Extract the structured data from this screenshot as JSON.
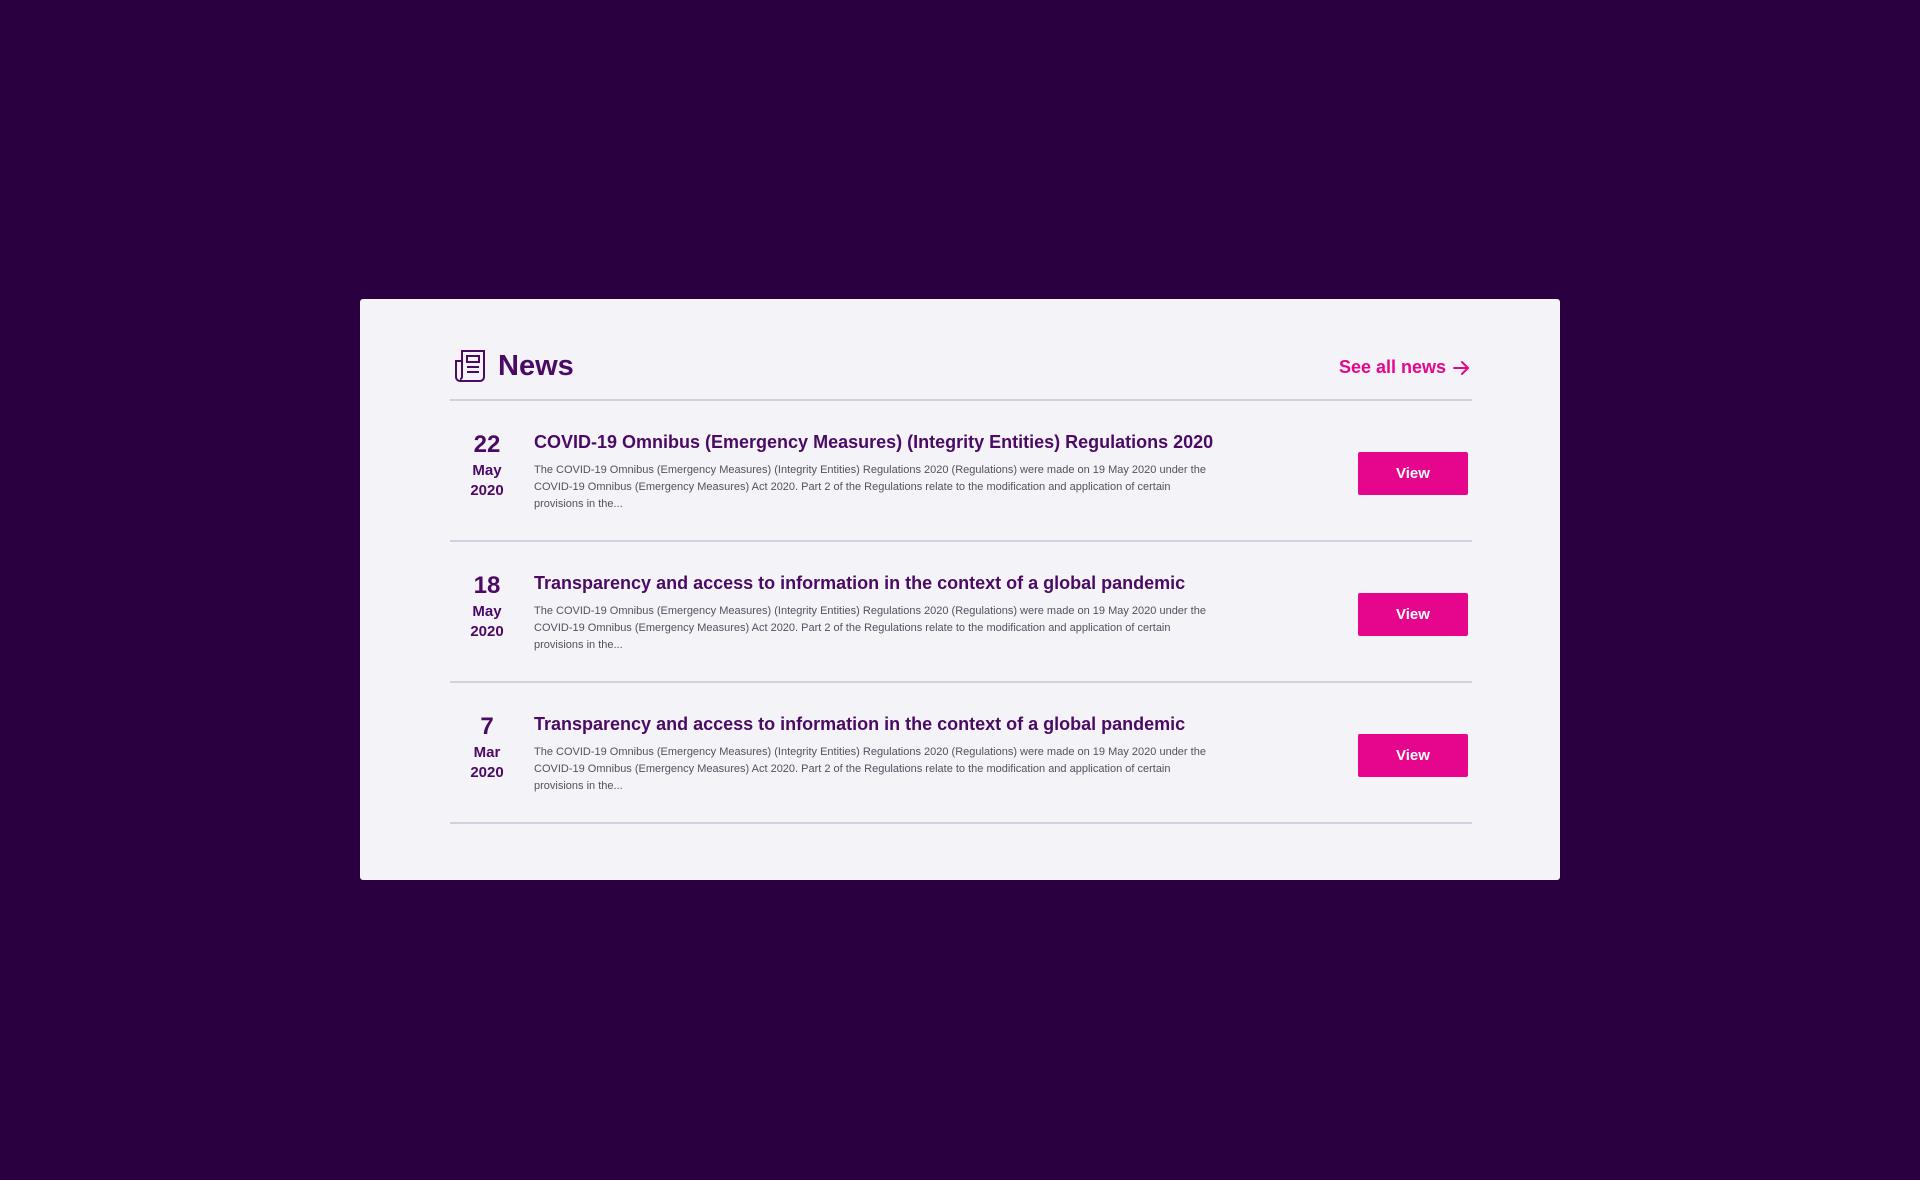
{
  "news": {
    "title": "News",
    "see_all_label": "See all news",
    "view_label": "View",
    "items": [
      {
        "day": "22",
        "month": "May",
        "year": "2020",
        "title": "COVID-19 Omnibus (Emergency Measures) (Integrity Entities) Regulations 2020",
        "excerpt": "The COVID-19 Omnibus (Emergency Measures) (Integrity Entities) Regulations 2020 (Regulations) were made on 19 May 2020 under the COVID-19 Omnibus (Emergency Measures) Act 2020. Part 2 of the Regulations relate to the modification and application of certain provisions in the..."
      },
      {
        "day": "18",
        "month": "May",
        "year": "2020",
        "title": "Transparency and access to information in the context of a global pandemic",
        "excerpt": "The COVID-19 Omnibus (Emergency Measures) (Integrity Entities) Regulations 2020 (Regulations) were made on 19 May 2020 under the COVID-19 Omnibus (Emergency Measures) Act 2020. Part 2 of the Regulations relate to the modification and application of certain provisions in the..."
      },
      {
        "day": "7",
        "month": "Mar",
        "year": "2020",
        "title": "Transparency and access to information in the context of a global pandemic",
        "excerpt": "The COVID-19 Omnibus (Emergency Measures) (Integrity Entities) Regulations 2020 (Regulations) were made on 19 May 2020 under the COVID-19 Omnibus (Emergency Measures) Act 2020. Part 2 of the Regulations relate to the modification and application of certain provisions in the..."
      }
    ]
  },
  "colors": {
    "background": "#2a0040",
    "panel": "#f4f3f8",
    "primary": "#4b0a64",
    "accent": "#e6068d",
    "divider": "#d3d1e0"
  },
  "icons": {
    "header": "newspaper-icon",
    "see_all": "arrow-right-icon"
  }
}
